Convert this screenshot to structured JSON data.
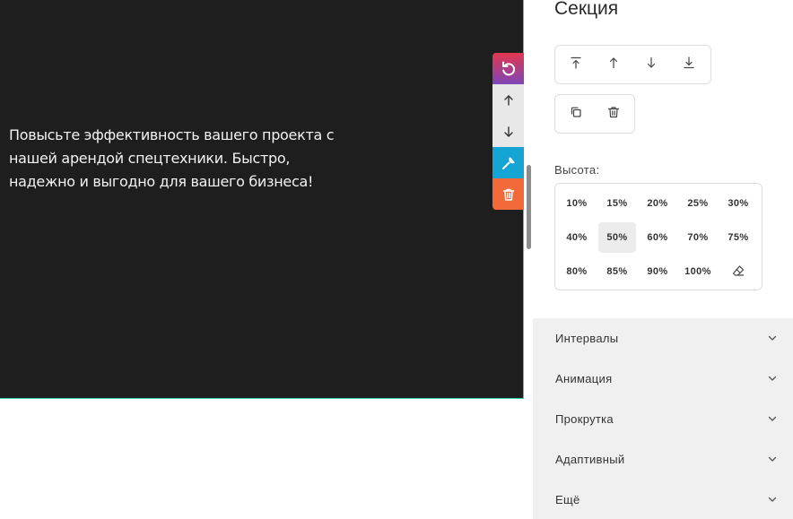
{
  "canvas": {
    "section_text": "Повысьте эффективность вашего проекта с нашей арендой спецтехники. Быстро, надежно и выгодно для вашего бизнеса!",
    "colors": {
      "section_bg": "#1e1e1e",
      "section_outline": "#2fd4a5"
    },
    "toolbar": {
      "buttons": [
        {
          "icon": "undo-icon",
          "color": "#e0384f"
        },
        {
          "icon": "arrow-up-icon",
          "color": "#e8e8e8"
        },
        {
          "icon": "arrow-down-icon",
          "color": "#e8e8e8"
        },
        {
          "icon": "wrench-icon",
          "color": "#14a5d4"
        },
        {
          "icon": "trash-icon",
          "color": "#f26a3a"
        }
      ]
    }
  },
  "panel": {
    "title": "Секция",
    "move_buttons": [
      "move-to-top-icon",
      "move-up-icon",
      "move-down-icon",
      "move-to-bottom-icon"
    ],
    "edit_buttons": [
      "copy-icon",
      "delete-icon"
    ],
    "height_label": "Высота:",
    "height_options": [
      "10%",
      "15%",
      "20%",
      "25%",
      "30%",
      "40%",
      "50%",
      "60%",
      "70%",
      "75%",
      "80%",
      "85%",
      "90%",
      "100%"
    ],
    "height_selected": "50%",
    "height_clear_icon": "eraser-icon",
    "accordions": [
      {
        "label": "Интервалы"
      },
      {
        "label": "Анимация"
      },
      {
        "label": "Прокрутка"
      },
      {
        "label": "Адаптивный"
      },
      {
        "label": "Ещё"
      }
    ]
  }
}
